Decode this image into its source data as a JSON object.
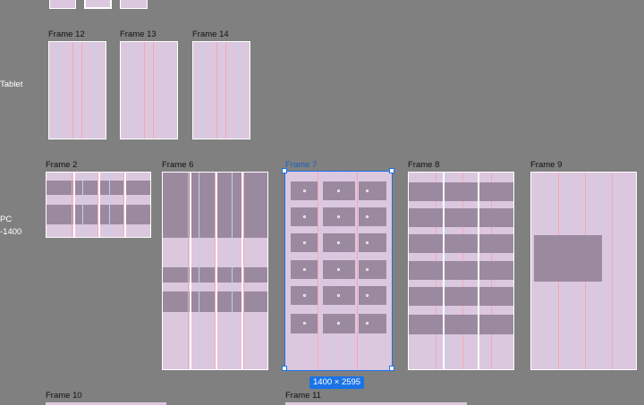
{
  "row_labels": {
    "tablet": "Tablet",
    "pc_line1": "PC",
    "pc_line2": "-1400"
  },
  "frames": {
    "f12": "Frame 12",
    "f13": "Frame 13",
    "f14": "Frame 14",
    "f2": "Frame 2",
    "f6": "Frame 6",
    "f7": "Frame 7",
    "f8": "Frame 8",
    "f9": "Frame 9",
    "f10": "Frame 10",
    "f11": "Frame 11"
  },
  "selection": {
    "frame": "Frame 7",
    "size_label": "1400 × 2595"
  },
  "colors": {
    "canvas": "#808080",
    "frame_fill": "#dcc8de",
    "block_fill": "#9b8a9f",
    "selection": "#1a73e8"
  }
}
